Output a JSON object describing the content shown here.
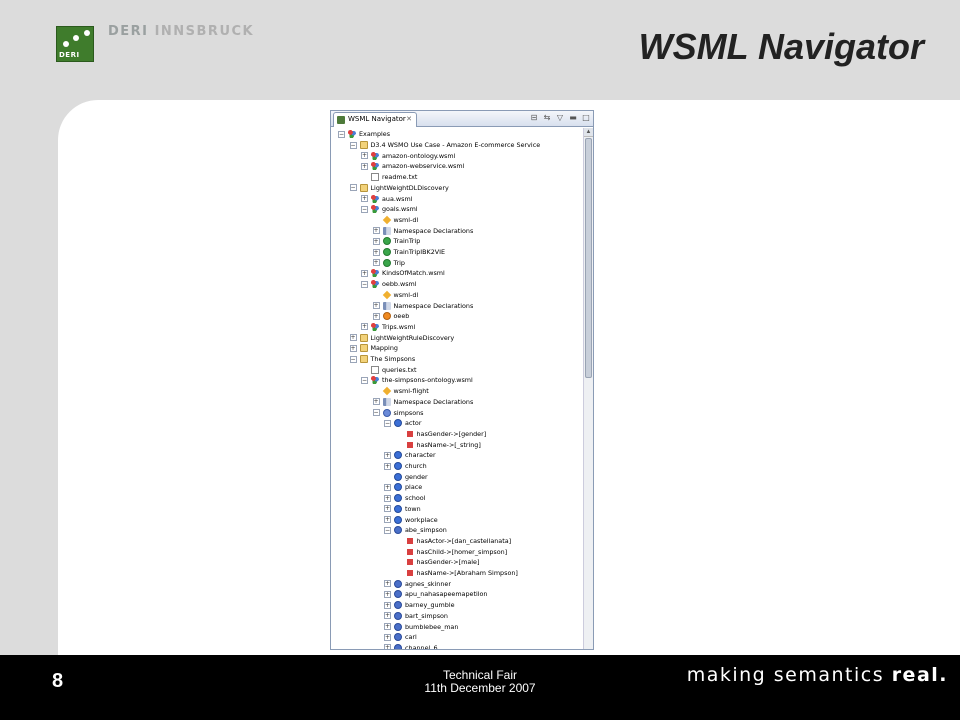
{
  "header": {
    "org_part1": "DERI",
    "org_part2": "INNSBRUCK",
    "logo_text": "DERI",
    "title": "WSML Navigator"
  },
  "navigator": {
    "tab_label": "WSML Navigator",
    "tree": [
      {
        "depth": 0,
        "toggle": "-",
        "icon": "wsml",
        "label": "Examples"
      },
      {
        "depth": 1,
        "toggle": "-",
        "icon": "folder",
        "label": "D3.4 WSMO Use Case - Amazon E-commerce Service"
      },
      {
        "depth": 2,
        "toggle": "+",
        "icon": "wsml",
        "label": "amazon-ontology.wsml"
      },
      {
        "depth": 2,
        "toggle": "+",
        "icon": "wsml",
        "label": "amazon-webservice.wsml"
      },
      {
        "depth": 2,
        "toggle": "",
        "icon": "txt",
        "label": "readme.txt"
      },
      {
        "depth": 1,
        "toggle": "-",
        "icon": "folder",
        "label": "LightWeightDLDiscovery"
      },
      {
        "depth": 2,
        "toggle": "+",
        "icon": "wsml",
        "label": "aua.wsml"
      },
      {
        "depth": 2,
        "toggle": "-",
        "icon": "wsml",
        "label": "goals.wsml"
      },
      {
        "depth": 3,
        "toggle": "",
        "icon": "diamond",
        "label": "wsml-dl"
      },
      {
        "depth": 3,
        "toggle": "+",
        "icon": "ns",
        "label": "Namespace Declarations"
      },
      {
        "depth": 3,
        "toggle": "+",
        "icon": "goal",
        "label": "TrainTrip"
      },
      {
        "depth": 3,
        "toggle": "+",
        "icon": "goal",
        "label": "TrainTripIBK2VIE"
      },
      {
        "depth": 3,
        "toggle": "+",
        "icon": "goal",
        "label": "Trip"
      },
      {
        "depth": 2,
        "toggle": "+",
        "icon": "wsml",
        "label": "KindsOfMatch.wsml"
      },
      {
        "depth": 2,
        "toggle": "-",
        "icon": "wsml",
        "label": "oebb.wsml"
      },
      {
        "depth": 3,
        "toggle": "",
        "icon": "diamond",
        "label": "wsml-dl"
      },
      {
        "depth": 3,
        "toggle": "+",
        "icon": "ns",
        "label": "Namespace Declarations"
      },
      {
        "depth": 3,
        "toggle": "+",
        "icon": "orange",
        "label": "oeeb"
      },
      {
        "depth": 2,
        "toggle": "+",
        "icon": "wsml",
        "label": "Trips.wsml"
      },
      {
        "depth": 1,
        "toggle": "+",
        "icon": "folder",
        "label": "LightWeightRuleDiscovery"
      },
      {
        "depth": 1,
        "toggle": "+",
        "icon": "folder",
        "label": "Mapping"
      },
      {
        "depth": 1,
        "toggle": "-",
        "icon": "folder",
        "label": "The Simpsons"
      },
      {
        "depth": 2,
        "toggle": "",
        "icon": "txt",
        "label": "queries.txt"
      },
      {
        "depth": 2,
        "toggle": "-",
        "icon": "wsml",
        "label": "the-simpsons-ontology.wsml"
      },
      {
        "depth": 3,
        "toggle": "",
        "icon": "diamond",
        "label": "wsml-flight"
      },
      {
        "depth": 3,
        "toggle": "+",
        "icon": "ns",
        "label": "Namespace Declarations"
      },
      {
        "depth": 3,
        "toggle": "-",
        "icon": "onto",
        "label": "simpsons"
      },
      {
        "depth": 4,
        "toggle": "-",
        "icon": "concept",
        "label": "actor"
      },
      {
        "depth": 5,
        "toggle": "",
        "icon": "attr",
        "label": "hasGender->[gender]"
      },
      {
        "depth": 5,
        "toggle": "",
        "icon": "attr",
        "label": "hasName->[_string]"
      },
      {
        "depth": 4,
        "toggle": "+",
        "icon": "concept",
        "label": "character"
      },
      {
        "depth": 4,
        "toggle": "+",
        "icon": "concept",
        "label": "church"
      },
      {
        "depth": 4,
        "toggle": "",
        "icon": "concept",
        "label": "gender"
      },
      {
        "depth": 4,
        "toggle": "+",
        "icon": "concept",
        "label": "place"
      },
      {
        "depth": 4,
        "toggle": "+",
        "icon": "concept",
        "label": "school"
      },
      {
        "depth": 4,
        "toggle": "+",
        "icon": "concept",
        "label": "town"
      },
      {
        "depth": 4,
        "toggle": "+",
        "icon": "concept",
        "label": "workplace"
      },
      {
        "depth": 4,
        "toggle": "-",
        "icon": "inst",
        "label": "abe_simpson"
      },
      {
        "depth": 5,
        "toggle": "",
        "icon": "attr",
        "label": "hasActor->[dan_castellanata]"
      },
      {
        "depth": 5,
        "toggle": "",
        "icon": "attr",
        "label": "hasChild->[homer_simpson]"
      },
      {
        "depth": 5,
        "toggle": "",
        "icon": "attr",
        "label": "hasGender->[male]"
      },
      {
        "depth": 5,
        "toggle": "",
        "icon": "attr",
        "label": "hasName->[Abraham Simpson]"
      },
      {
        "depth": 4,
        "toggle": "+",
        "icon": "inst",
        "label": "agnes_skinner"
      },
      {
        "depth": 4,
        "toggle": "+",
        "icon": "inst",
        "label": "apu_nahasapeemapetilon"
      },
      {
        "depth": 4,
        "toggle": "+",
        "icon": "inst",
        "label": "barney_gumble"
      },
      {
        "depth": 4,
        "toggle": "+",
        "icon": "inst",
        "label": "bart_simpson"
      },
      {
        "depth": 4,
        "toggle": "+",
        "icon": "inst",
        "label": "bumblebee_man"
      },
      {
        "depth": 4,
        "toggle": "+",
        "icon": "inst",
        "label": "carl"
      },
      {
        "depth": 4,
        "toggle": "+",
        "icon": "inst",
        "label": "channel_6"
      }
    ]
  },
  "footer": {
    "page_number": "8",
    "event": "Technical Fair",
    "date": "11th December 2007",
    "tagline_part1": "making semantics",
    "tagline_part2": "real."
  },
  "colors": {
    "footer_bg": "#000000",
    "slide_bg": "#dcdcdc",
    "logo_green": "#3f7c2c"
  }
}
